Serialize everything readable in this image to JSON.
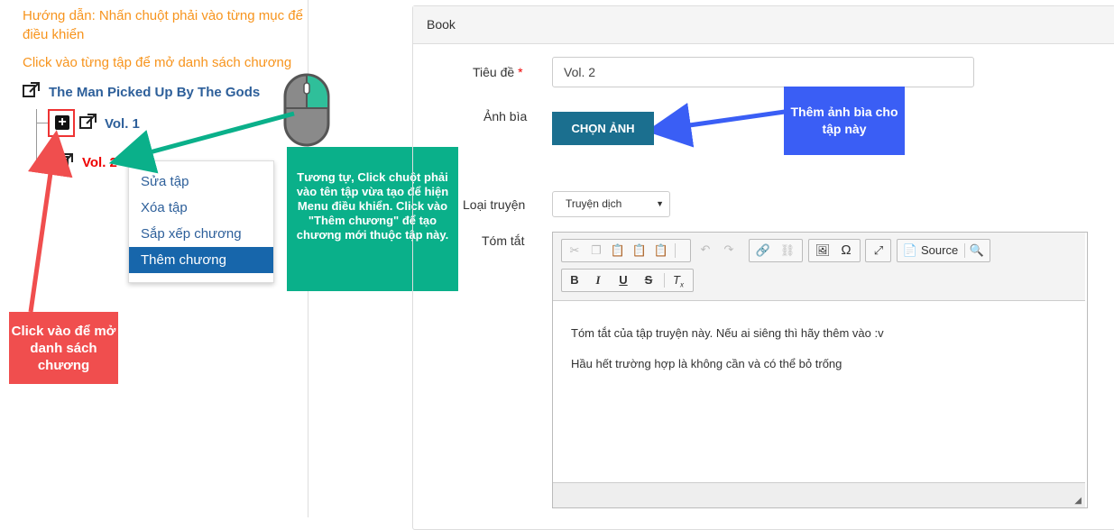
{
  "left": {
    "guide_text": "Hướng dẫn: Nhấn chuột phải vào từng mục để điều khiển",
    "click_hint": "Click vào từng tập để mở danh sách chương",
    "tree": {
      "root_title": "The Man Picked Up By The Gods",
      "vol1": "Vol. 1",
      "vol2": "Vol. 2"
    },
    "context_menu": [
      "Sửa tập",
      "Xóa tập",
      "Sắp xếp chương",
      "Thêm chương"
    ]
  },
  "annotations": {
    "red_note": "Click vào để mở danh sách chương",
    "green_note": "Tương tự, Click chuột phải vào tên tập vừa tạo để hiện Menu điều khiển. Click vào \"Thêm chương\" để tạo chương mới thuộc tập này.",
    "blue_note": "Thêm ảnh bìa cho tập  này"
  },
  "form": {
    "panel_title": "Book",
    "title_label": "Tiêu đề",
    "required_mark": "*",
    "title_value": "Vol. 2",
    "cover_label": "Ảnh bìa",
    "choose_image_button": "CHỌN ẢNH",
    "type_label": "Loại truyện",
    "type_value": "Truyện dịch",
    "summary_label": "Tóm tắt",
    "editor": {
      "source_label": "Source",
      "line1": "Tóm tắt của tập truyện này. Nếu ai siêng thì hãy thêm vào :v",
      "line2": "Hầu hết trường hợp là không cần và có thể bỏ trống"
    }
  },
  "colors": {
    "orange": "#f7941d",
    "link_blue": "#2d5f9a",
    "red": "#f04e4e",
    "green": "#0ab08a",
    "blue": "#3a5ef5",
    "button": "#1b6f8f"
  }
}
